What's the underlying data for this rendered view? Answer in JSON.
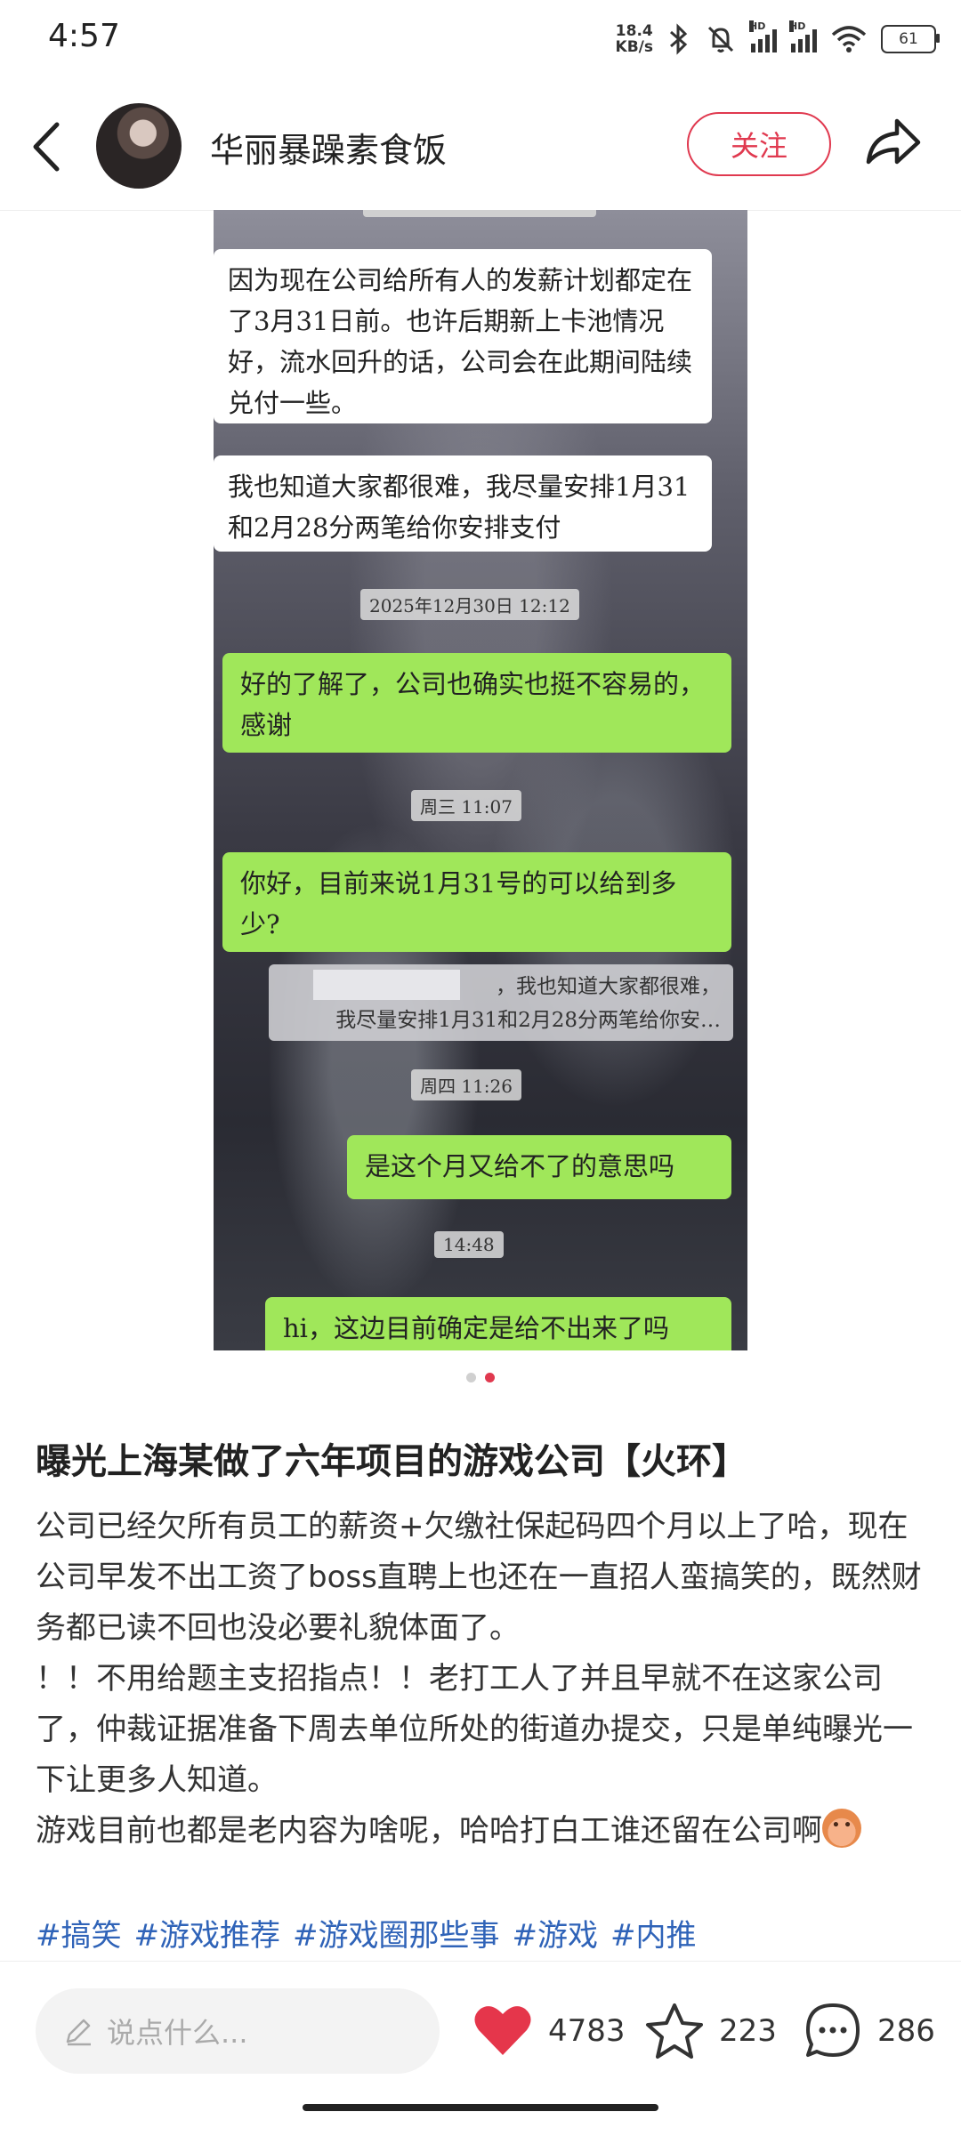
{
  "status_bar": {
    "time": "4:57",
    "net_speed_value": "18.4",
    "net_speed_unit": "KB/s",
    "signal1_label": "HD",
    "signal2_label": "HD",
    "battery": "61"
  },
  "header": {
    "username": "华丽暴躁素食饭",
    "follow_label": "关注"
  },
  "chat": {
    "msg1": "因为现在公司给所有人的发薪计划都定在了3月31日前。也许后期新上卡池情况好，流水回升的话，公司会在此期间陆续兑付一些。",
    "msg2": "我也知道大家都很难，我尽量安排1月31和2月28分两笔给你安排支付",
    "time1": "2025年12月30日 12:12",
    "msg3": "好的了解了，公司也确实也挺不容易的，感谢",
    "time2": "周三 11:07",
    "msg4": "你好，目前来说1月31号的可以给到多少?",
    "quote_line1": "，我也知道大家都很难，",
    "quote_line2": "我尽量安排1月31和2月28分两笔给你安…",
    "time3": "周四 11:26",
    "msg5": "是这个月又给不了的意思吗",
    "time4": "14:48",
    "msg6": "hi，这边目前确定是给不出来了吗"
  },
  "carousel": {
    "total": 2,
    "active": 2
  },
  "post": {
    "title": "曝光上海某做了六年项目的游戏公司【火环】",
    "para1": "公司已经欠所有员工的薪资+欠缴社保起码四个月以上了哈，现在公司早发不出工资了boss直聘上也还在一直招人蛮搞笑的，既然财务都已读不回也没必要礼貌体面了。",
    "para2": "！！不用给题主支招指点！！老打工人了并且早就不在这家公司了，仲裁证据准备下周去单位所处的街道办提交，只是单纯曝光一下让更多人知道。",
    "para3": "游戏目前也都是老内容为啥呢，哈哈打白工谁还留在公司啊",
    "tags": [
      "#搞笑",
      "#游戏推荐",
      "#游戏圈那些事",
      "#游戏",
      "#内推"
    ]
  },
  "bottom_bar": {
    "comment_placeholder": "说点什么...",
    "likes": "4783",
    "favorites": "223",
    "comments": "286"
  },
  "colors": {
    "accent": "#e0394f",
    "bubble_out": "#a0e75a",
    "tag": "#2f63b8"
  }
}
